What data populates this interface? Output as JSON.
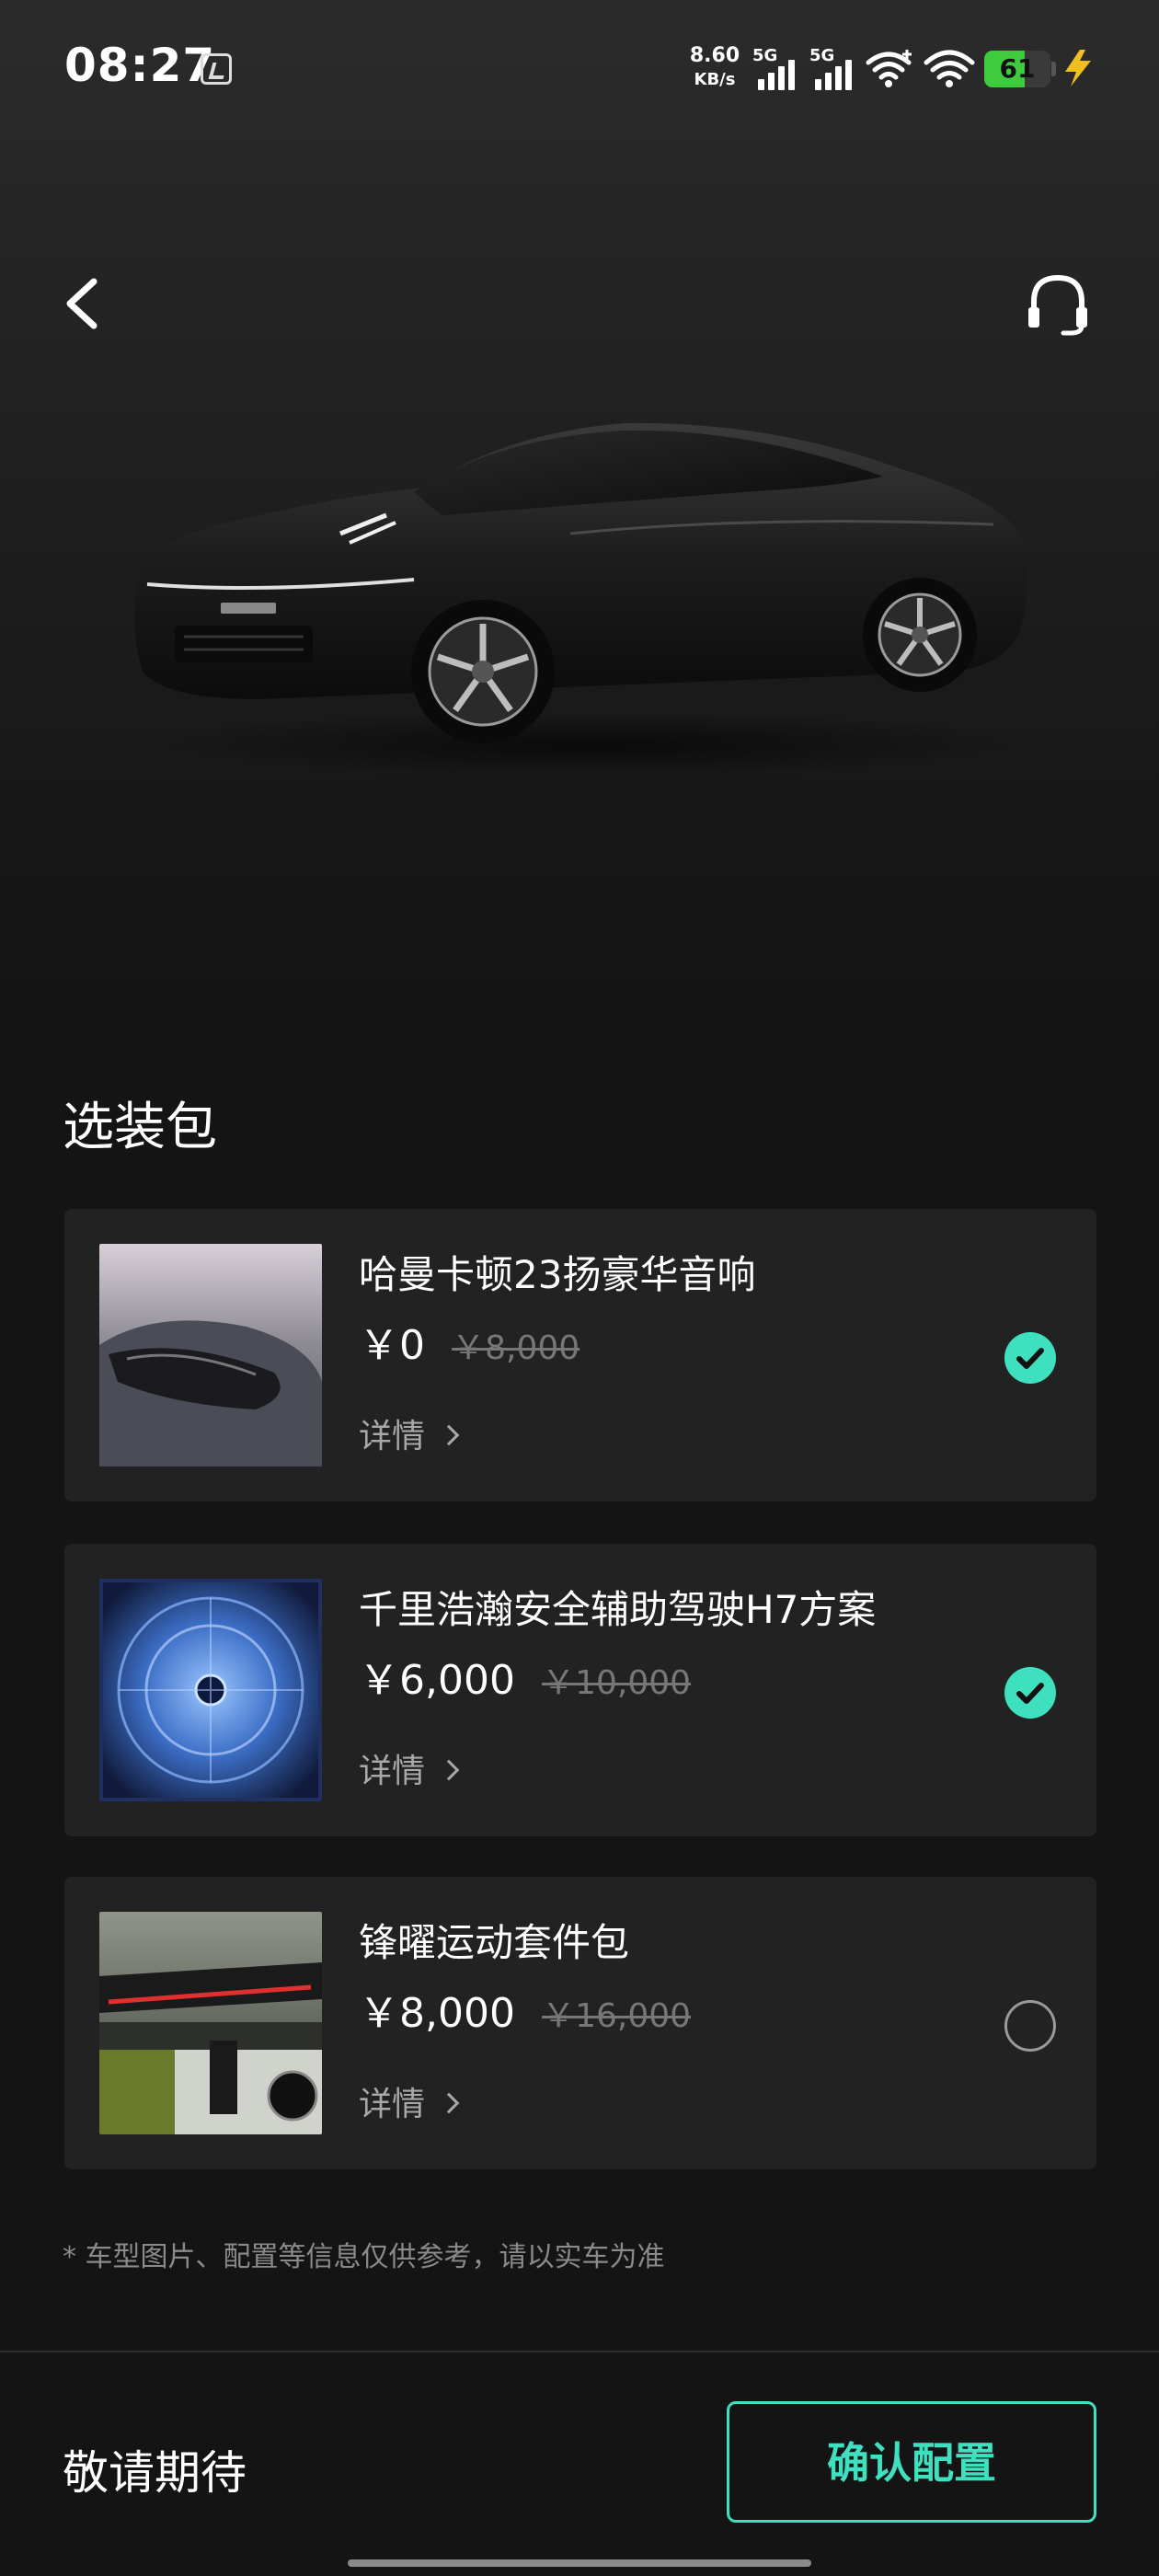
{
  "status_bar": {
    "time": "08:27",
    "net_speed_value": "8.60",
    "net_speed_unit": "KB/s",
    "signal_1_label": "5G",
    "signal_2_label": "5G",
    "battery_level": "61",
    "battery_fraction": 0.61
  },
  "header": {
    "back_icon": "chevron-left-icon",
    "support_icon": "headset-icon"
  },
  "section": {
    "title": "选装包"
  },
  "packages": [
    {
      "title": "哈曼卡顿23扬豪华音响",
      "price": "￥0",
      "original_price": "￥8,000",
      "detail_label": "详情",
      "selected": true
    },
    {
      "title": "千里浩瀚安全辅助驾驶H7方案",
      "price": "￥6,000",
      "original_price": "￥10,000",
      "detail_label": "详情",
      "selected": true
    },
    {
      "title": "锋曜运动套件包",
      "price": "￥8,000",
      "original_price": "￥16,000",
      "detail_label": "详情",
      "selected": false
    }
  ],
  "disclaimer": "* 车型图片、配置等信息仅供参考，请以实车为准",
  "footer": {
    "status_text": "敬请期待",
    "confirm_label": "确认配置"
  },
  "colors": {
    "accent": "#3fe0c0",
    "card_bg": "#222222",
    "page_bg": "#141414",
    "battery_green": "#3ecc3e"
  }
}
